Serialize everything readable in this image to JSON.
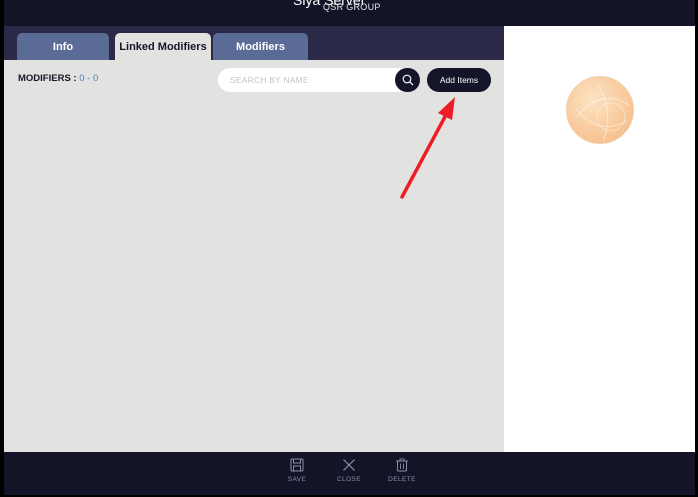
{
  "header": {
    "title": "Siya Server",
    "subtitle": "QSR GROUP"
  },
  "tabs": [
    {
      "label": "Info",
      "active": false
    },
    {
      "label": "Linked Modifiers",
      "active": true
    },
    {
      "label": "Modifiers",
      "active": false
    }
  ],
  "content": {
    "modifiers_label": "MODIFIERS :",
    "modifiers_count": "0 - 0",
    "search": {
      "placeholder": "SEARCH BY NAME",
      "value": ""
    },
    "add_button_label": "Add Items"
  },
  "footer": {
    "save_label": "SAVE",
    "close_label": "CLOSE",
    "delete_label": "DELETE"
  },
  "icons": {
    "search": "search-icon",
    "save": "save-icon",
    "close": "close-icon",
    "delete": "trash-icon",
    "avatar": "avatar-placeholder"
  },
  "colors": {
    "dark_navy": "#141428",
    "tab_bar": "#2a2a48",
    "tab_inactive": "#5a6b95",
    "content_bg": "#e2e2e0",
    "count_blue": "#4a7ec4",
    "annotation_red": "#ee1c24"
  }
}
